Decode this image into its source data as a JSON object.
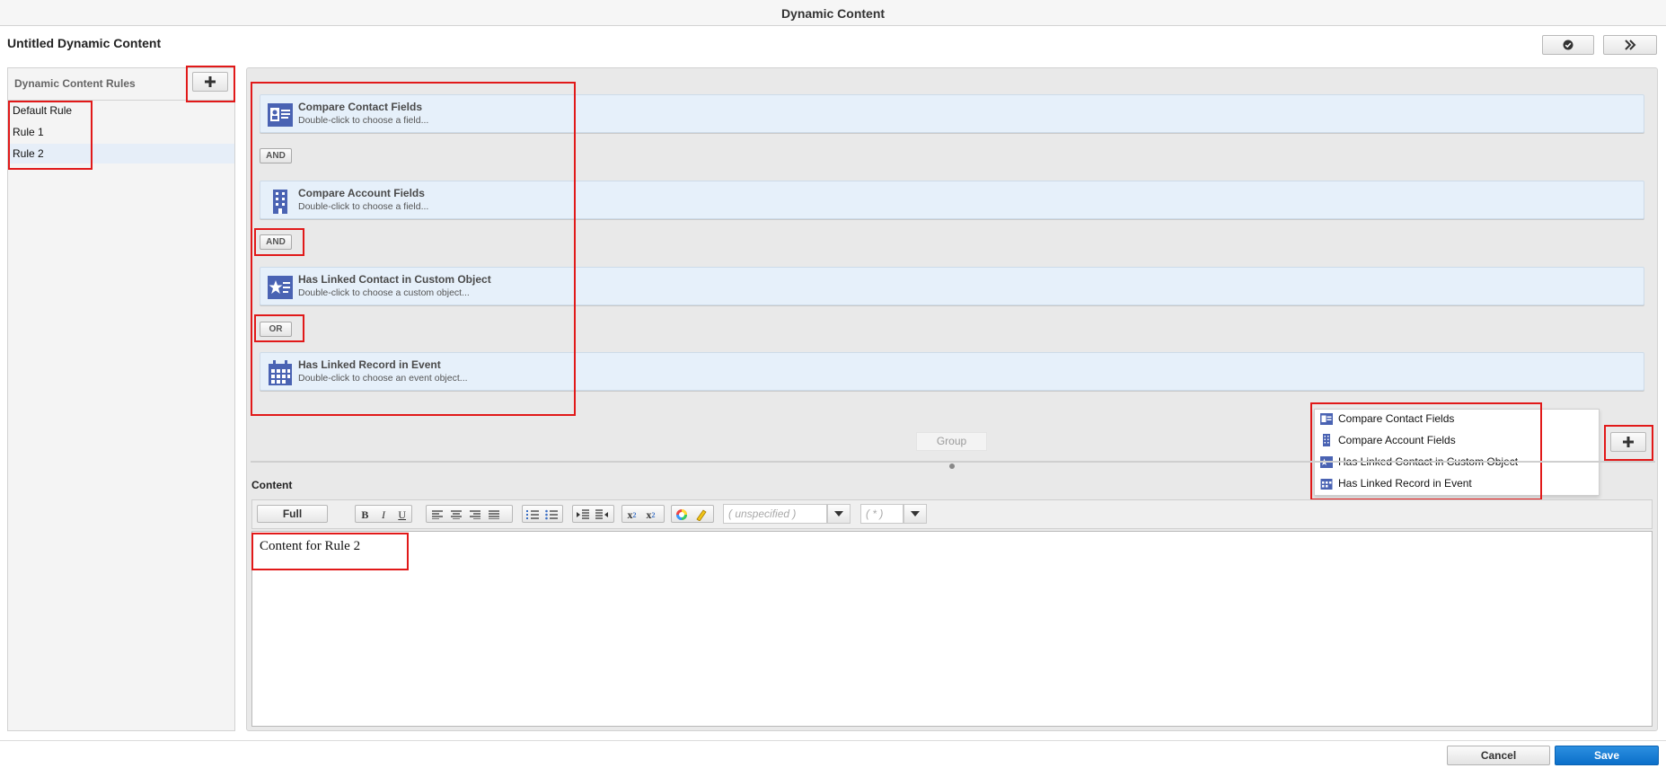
{
  "window": {
    "title": "Dynamic Content"
  },
  "header": {
    "page_title": "Untitled Dynamic Content",
    "check_icon": "check-circle-icon",
    "expand_icon": "double-chevron-right-icon"
  },
  "rules_panel": {
    "title": "Dynamic Content Rules",
    "add_icon": "plus-icon",
    "rules": [
      {
        "label": "Default Rule",
        "selected": false
      },
      {
        "label": "Rule 1",
        "selected": false
      },
      {
        "label": "Rule 2",
        "selected": true
      }
    ]
  },
  "criteria": [
    {
      "title": "Compare Contact Fields",
      "subtitle": "Double-click to choose a field...",
      "icon": "contact-card-icon"
    },
    {
      "title": "Compare Account Fields",
      "subtitle": "Double-click to choose a field...",
      "icon": "building-icon"
    },
    {
      "title": "Has Linked Contact in Custom Object",
      "subtitle": "Double-click to choose a custom object...",
      "icon": "star-card-icon"
    },
    {
      "title": "Has Linked Record in Event",
      "subtitle": "Double-click to choose an event object...",
      "icon": "calendar-icon"
    }
  ],
  "operators": [
    "AND",
    "AND",
    "OR"
  ],
  "group_button": "Group",
  "add_menu": {
    "items": [
      {
        "label": "Compare Contact Fields",
        "icon": "contact-card-icon"
      },
      {
        "label": "Compare Account Fields",
        "icon": "building-icon"
      },
      {
        "label": "Has Linked Contact in Custom Object",
        "icon": "star-card-icon"
      },
      {
        "label": "Has Linked Record in Event",
        "icon": "calendar-icon"
      }
    ]
  },
  "content": {
    "label": "Content",
    "mode_button": "Full",
    "font_select_placeholder": "( unspecified )",
    "size_select_placeholder": "( * )",
    "body_text": "Content for Rule 2"
  },
  "footer": {
    "cancel": "Cancel",
    "save": "Save"
  },
  "colors": {
    "accent": "#0b6fc9",
    "icon_blue": "#4a63b3",
    "highlight": "#e11919"
  }
}
